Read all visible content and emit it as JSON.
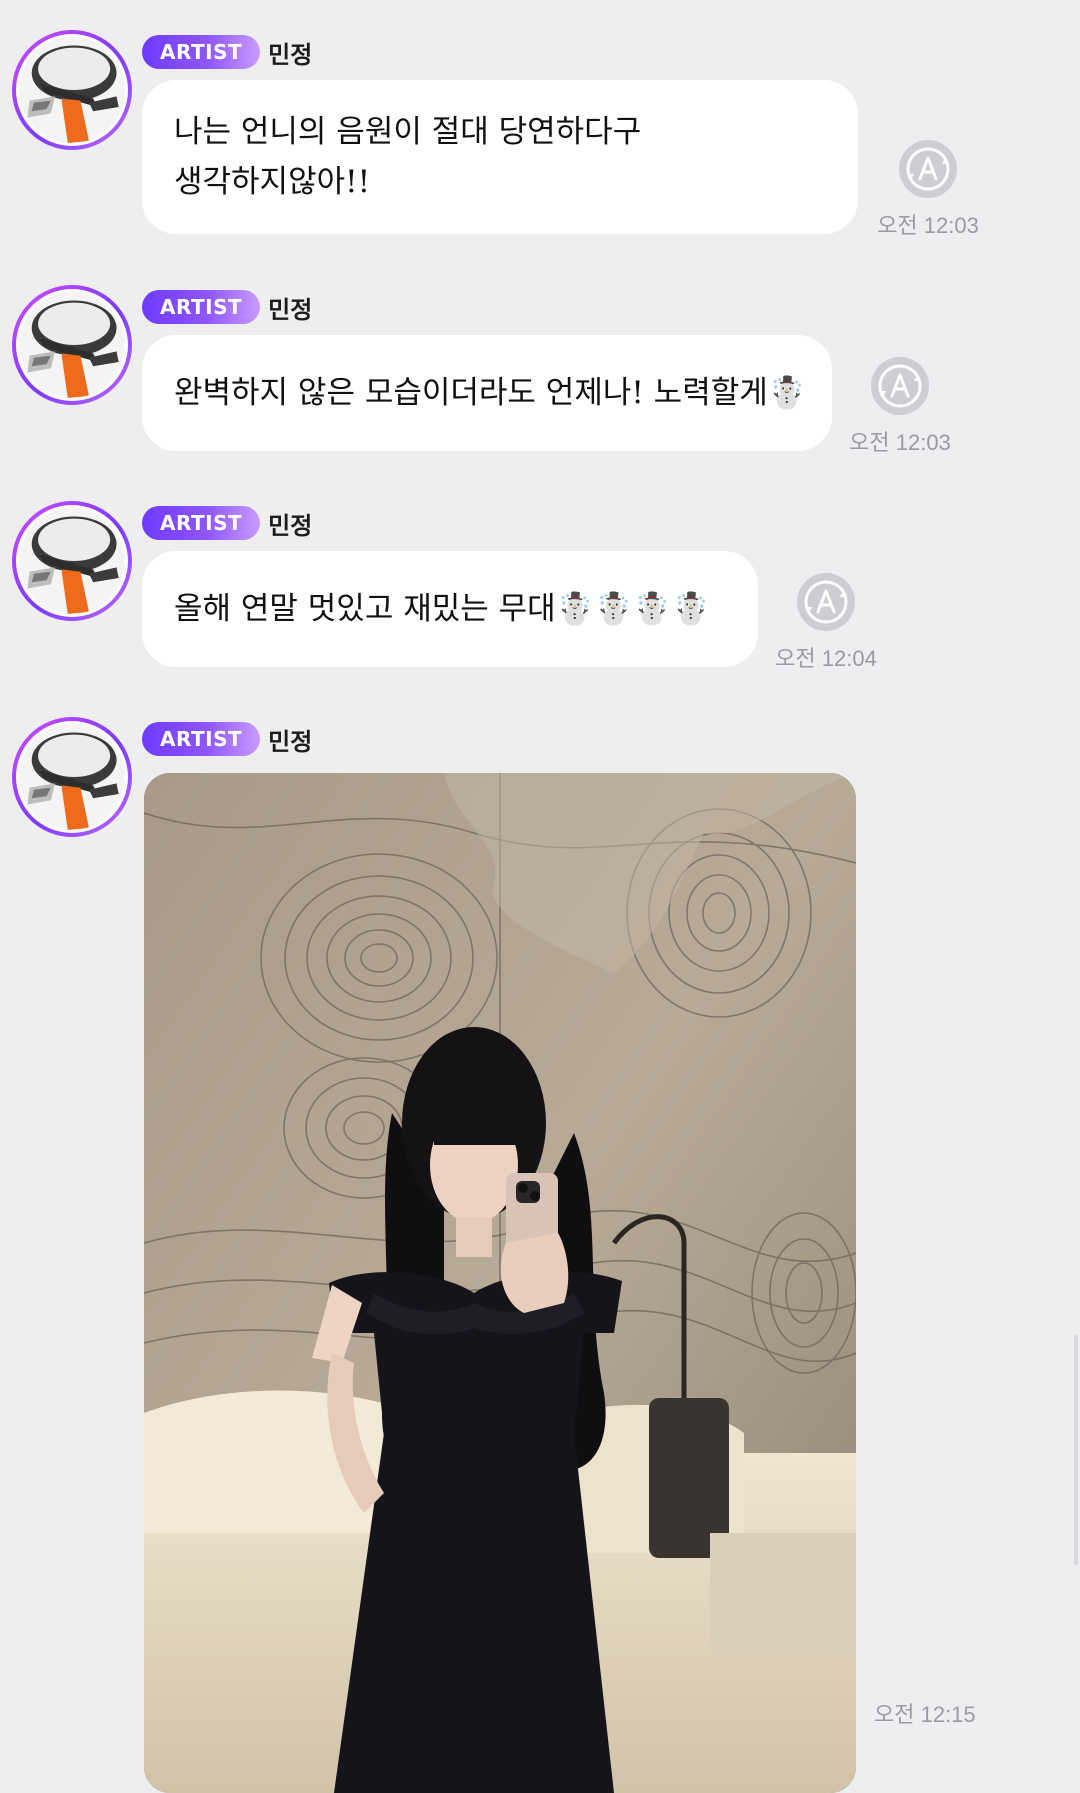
{
  "messages": [
    {
      "badge": "ARTIST",
      "sender": "민정",
      "lines": [
        "나는 언니의 음원이 절대 당연하다구",
        "생각하지않아!!"
      ],
      "time": "오전 12:03"
    },
    {
      "badge": "ARTIST",
      "sender": "민정",
      "lines": [
        "완벽하지 않은 모습이더라도 언제나! 노력할게☃️"
      ],
      "time": "오전 12:03"
    },
    {
      "badge": "ARTIST",
      "sender": "민정",
      "lines": [
        "올해 연말 멋있고 재밌는 무대☃️☃️☃️☃️"
      ],
      "time": "오전 12:04"
    },
    {
      "badge": "ARTIST",
      "sender": "민정",
      "image": "photo",
      "time": "오전 12:15"
    }
  ],
  "icons": {
    "status": "translate-icon",
    "avatar": "profile-avatar"
  },
  "colors": {
    "background": "#eeeef0",
    "bubble": "#ffffff",
    "badge_start": "#6d3bff",
    "badge_end": "#c99bff",
    "time_text": "#9b9ba0"
  }
}
